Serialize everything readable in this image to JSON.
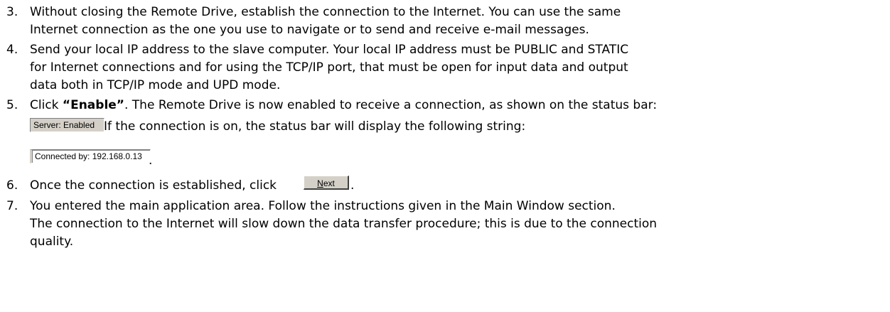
{
  "items": [
    {
      "number": "3.",
      "lines": [
        "Without closing the Remote Drive, establish the connection to the Internet. You can use the same",
        "Internet connection as the one you use to navigate or to send and receive e-mail messages."
      ]
    },
    {
      "number": "4.",
      "lines": [
        "Send your local IP address to the slave computer. Your local IP address must be PUBLIC and STATIC",
        "for Internet connections and for using the TCP/IP port, that must be open for input data and output",
        "data both in TCP/IP mode and UPD mode."
      ]
    },
    {
      "number": "5.",
      "prefix": "Click ",
      "bold": "“Enable”",
      "suffix": ". The Remote Drive is now enabled to receive a connection, as shown on the status bar:",
      "status_enabled": "Server: Enabled",
      "connected_text": "If the connection is on, the status bar will display the following string:",
      "status_connected": "Connected by: 192.168.0.13",
      "trailing": "."
    },
    {
      "number": "6.",
      "text": "Once the connection is established, click",
      "button_mnemonic": "N",
      "button_rest": "ext",
      "trailing": "."
    },
    {
      "number": "7.",
      "lines": [
        "You entered the main application area. Follow the instructions given in the Main Window section.",
        "The connection to the Internet will slow down the data transfer procedure; this is due to the connection",
        "quality."
      ]
    }
  ]
}
